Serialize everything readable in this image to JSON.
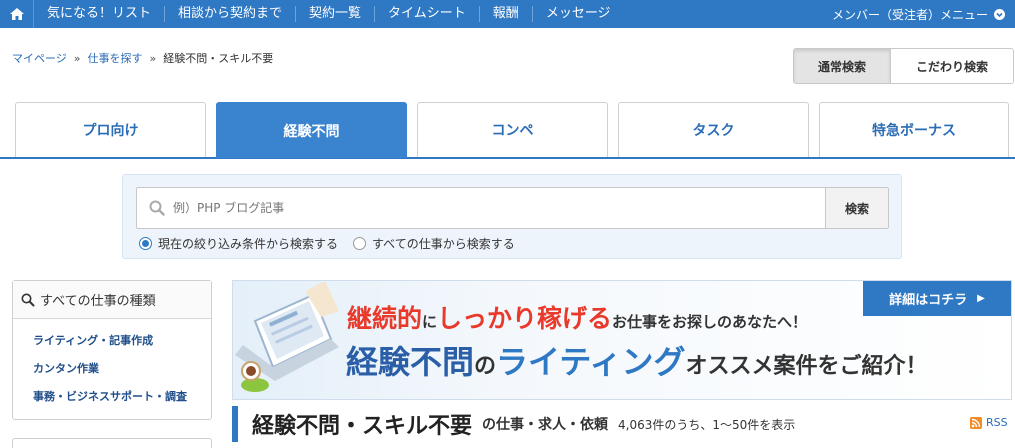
{
  "nav": {
    "items": [
      {
        "label": "気になる！リスト"
      },
      {
        "label": "相談から契約まで"
      },
      {
        "label": "契約一覧"
      },
      {
        "label": "タイムシート"
      },
      {
        "label": "報酬"
      },
      {
        "label": "メッセージ"
      }
    ],
    "member_menu": "メンバー（受注者）メニュー",
    "home_icon": "home-icon",
    "chevron_icon": "chevron-down-icon"
  },
  "breadcrumb": {
    "items": [
      "マイページ",
      "仕事を探す",
      "経験不問・スキル不要"
    ],
    "separator": "»"
  },
  "search_modes": {
    "normal": "通常検索",
    "advanced": "こだわり検索",
    "selected": "通常検索"
  },
  "tabs": {
    "items": [
      {
        "label": "プロ向け"
      },
      {
        "label": "経験不問"
      },
      {
        "label": "コンペ"
      },
      {
        "label": "タスク"
      },
      {
        "label": "特急ボーナス"
      }
    ],
    "selected": "経験不問"
  },
  "search": {
    "placeholder": "例）PHP ブログ記事",
    "value": "",
    "button": "検索",
    "radio_options": [
      {
        "label": "現在の絞り込み条件から検索する",
        "checked": true
      },
      {
        "label": "すべての仕事から検索する",
        "checked": false
      }
    ]
  },
  "sidebar": {
    "heading": "すべての仕事の種類",
    "items": [
      {
        "label": "ライティング・記事作成"
      },
      {
        "label": "カンタン作業"
      },
      {
        "label": "事務・ビジネスサポート・調査"
      }
    ]
  },
  "banner": {
    "detail_button": "詳細はコチラ",
    "line1": {
      "a": "継続的",
      "b": "に",
      "c": "しっかり稼げる",
      "d": "お仕事をお探しのあなたへ！"
    },
    "line2": {
      "a": "経験不問",
      "b": "の",
      "c": "ライティング",
      "d": "オススメ案件をご紹介！"
    }
  },
  "results": {
    "title": "経験不問・スキル不要",
    "subtitle": "の仕事・求人・依頼",
    "count_text": "4,063件のうち、1〜50件を表示",
    "rss": "RSS"
  },
  "colors": {
    "brand_blue": "#2f78c4",
    "accent_red": "#e8392b",
    "rss_orange": "#f28c28"
  }
}
